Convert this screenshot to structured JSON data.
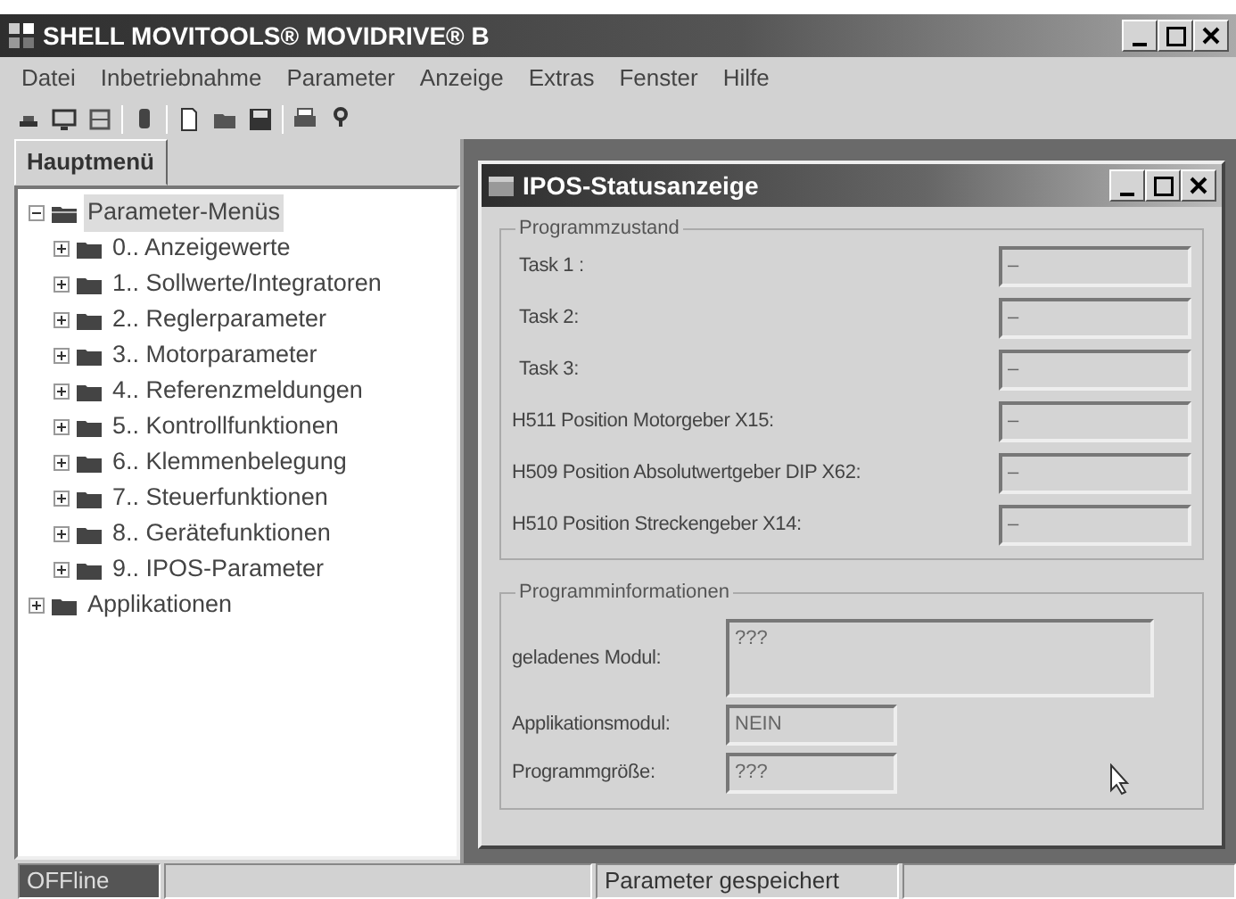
{
  "window": {
    "title": "SHELL MOVITOOLS® MOVIDRIVE® B"
  },
  "menu": [
    "Datei",
    "Inbetriebnahme",
    "Parameter",
    "Anzeige",
    "Extras",
    "Fenster",
    "Hilfe"
  ],
  "toolbar": [
    {
      "kind": "icon"
    },
    {
      "kind": "icon"
    },
    {
      "kind": "icon"
    },
    {
      "kind": "separator"
    },
    {
      "kind": "icon"
    },
    {
      "kind": "separator"
    },
    {
      "kind": "icon"
    },
    {
      "kind": "icon"
    },
    {
      "kind": "icon"
    },
    {
      "kind": "separator"
    },
    {
      "kind": "icon"
    },
    {
      "kind": "icon"
    }
  ],
  "sidebar": {
    "tab": "Hauptmenü",
    "tree": [
      {
        "label": "Parameter-Menüs",
        "expanded": true,
        "selected": true,
        "children": [
          {
            "label": "0.. Anzeigewerte",
            "expanded": false,
            "selected": false
          },
          {
            "label": "1.. Sollwerte/Integratoren",
            "expanded": false,
            "selected": false
          },
          {
            "label": "2.. Reglerparameter",
            "expanded": false,
            "selected": false
          },
          {
            "label": "3.. Motorparameter",
            "expanded": false,
            "selected": false
          },
          {
            "label": "4.. Referenzmeldungen",
            "expanded": false,
            "selected": false
          },
          {
            "label": "5.. Kontrollfunktionen",
            "expanded": false,
            "selected": false
          },
          {
            "label": "6.. Klemmenbelegung",
            "expanded": false,
            "selected": false
          },
          {
            "label": "7.. Steuerfunktionen",
            "expanded": false,
            "selected": false
          },
          {
            "label": "8.. Gerätefunktionen",
            "expanded": false,
            "selected": false
          },
          {
            "label": "9.. IPOS-Parameter",
            "expanded": false,
            "selected": false
          }
        ]
      },
      {
        "label": "Applikationen",
        "expanded": false,
        "selected": false
      }
    ]
  },
  "dialog": {
    "title": "IPOS-Statusanzeige",
    "program_state": {
      "title": "Programmzustand",
      "fields": [
        {
          "label": "Task 1 :",
          "value": "–"
        },
        {
          "label": "Task 2:",
          "value": "–"
        },
        {
          "label": "Task 3:",
          "value": "–"
        },
        {
          "label": "H511 Position Motorgeber X15:",
          "value": "–"
        },
        {
          "label": "H509 Position Absolutwertgeber DIP X62:",
          "value": "–"
        },
        {
          "label": "H510 Position Streckengeber X14:",
          "value": "–"
        }
      ]
    },
    "program_info": {
      "title": "Programminformationen",
      "fields": [
        {
          "label": "geladenes Modul:",
          "value": "???",
          "kind": "multiline"
        },
        {
          "label": "Applikationsmodul:",
          "value": "NEIN",
          "kind": "short"
        },
        {
          "label": "Programmgröße:",
          "value": "???",
          "kind": "short"
        }
      ]
    }
  },
  "status_bar": {
    "mode": "OFFline",
    "message": "Parameter gespeichert"
  }
}
